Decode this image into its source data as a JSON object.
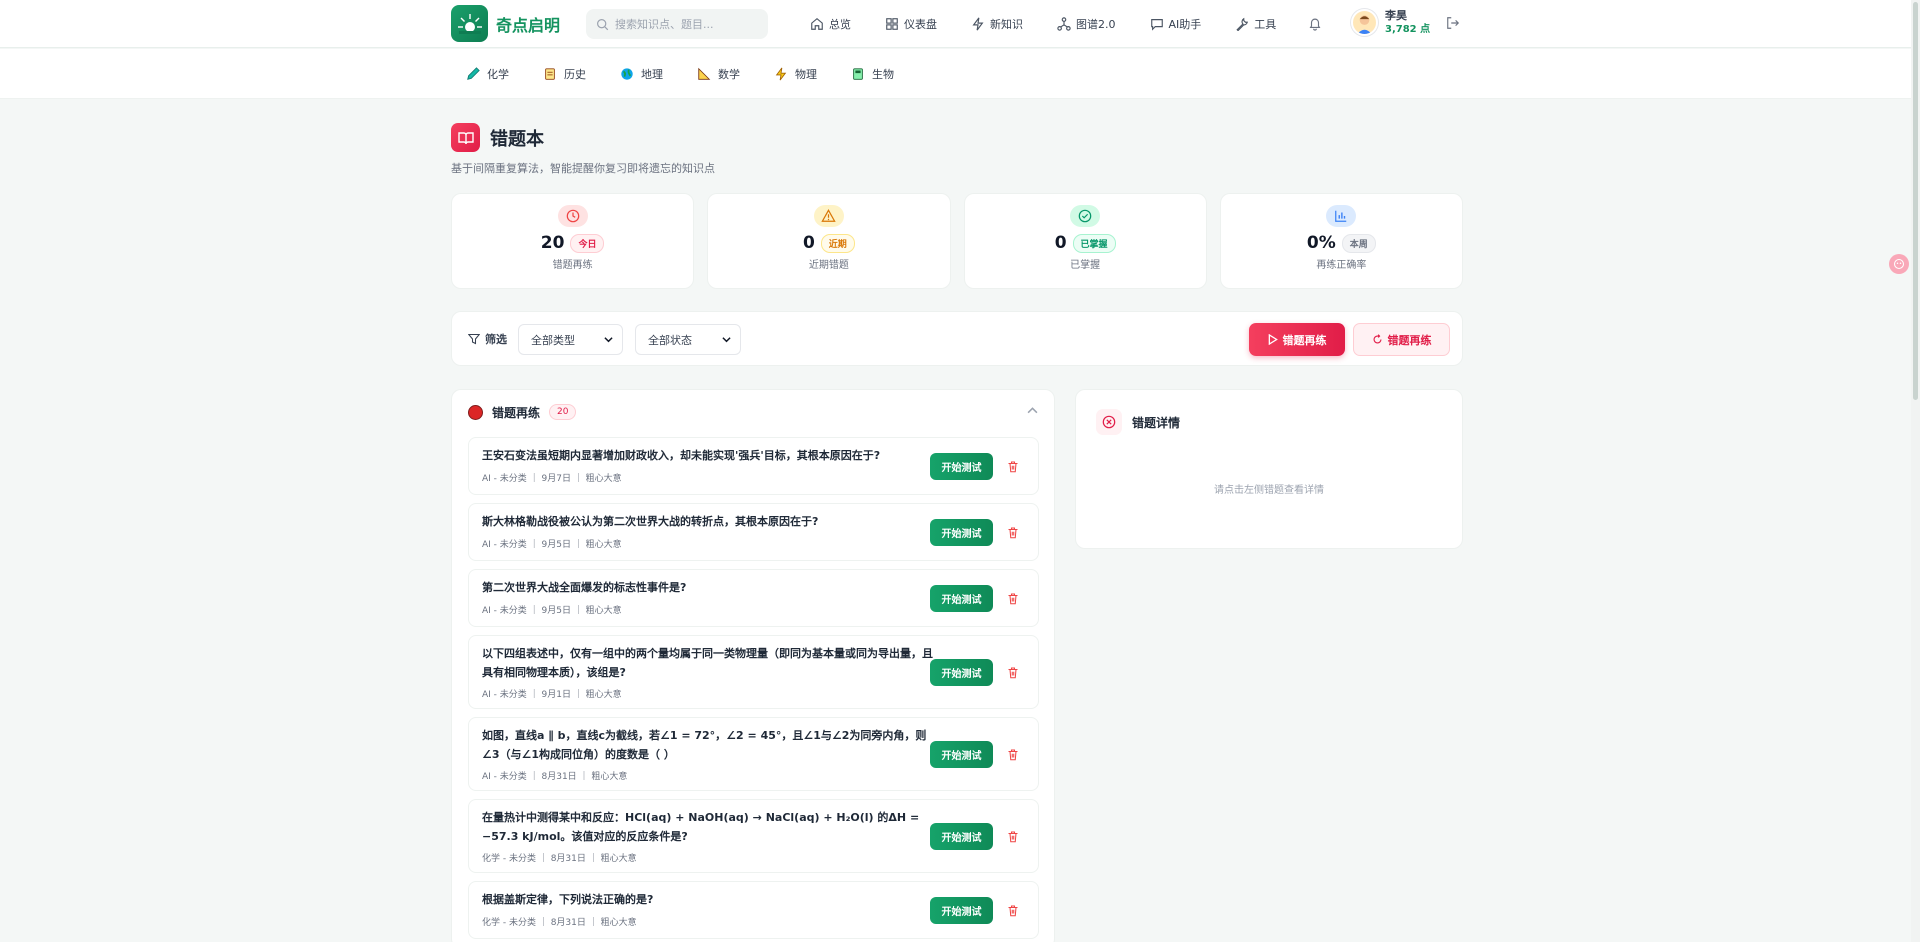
{
  "brand": {
    "name": "奇点启明"
  },
  "search": {
    "placeholder": "搜索知识点、题目..."
  },
  "nav": {
    "items": [
      {
        "label": "总览",
        "icon": "home-icon"
      },
      {
        "label": "仪表盘",
        "icon": "dashboard-icon"
      },
      {
        "label": "新知识",
        "icon": "lightning-icon"
      },
      {
        "label": "图谱2.0",
        "icon": "graph-icon"
      },
      {
        "label": "AI助手",
        "icon": "chat-icon"
      },
      {
        "label": "工具",
        "icon": "wrench-icon"
      }
    ]
  },
  "user": {
    "name": "李昊",
    "points": "3,782 点"
  },
  "subjects": [
    {
      "label": "化学",
      "icon": "flask-icon"
    },
    {
      "label": "历史",
      "icon": "scroll-icon"
    },
    {
      "label": "地理",
      "icon": "globe-icon"
    },
    {
      "label": "数学",
      "icon": "ruler-icon"
    },
    {
      "label": "物理",
      "icon": "bolt-icon"
    },
    {
      "label": "生物",
      "icon": "book-icon"
    }
  ],
  "page": {
    "title": "错题本",
    "subtitle": "基于间隔重复算法，智能提醒你复习即将遗忘的知识点"
  },
  "stats": [
    {
      "value": "20",
      "badge": "今日",
      "label": "错题再练",
      "color": "#ef4444",
      "bg": "#fee2e2",
      "badge_bg": "#fff1f2",
      "badge_color": "#e11d48",
      "badge_border": "#fecdd3"
    },
    {
      "value": "0",
      "badge": "近期",
      "label": "近期错题",
      "color": "#d97706",
      "bg": "#fef3c7",
      "badge_bg": "#fffbeb",
      "badge_color": "#d97706",
      "badge_border": "#fde68a"
    },
    {
      "value": "0",
      "badge": "已掌握",
      "label": "已掌握",
      "color": "#059669",
      "bg": "#d1fae5",
      "badge_bg": "#ecfdf5",
      "badge_color": "#059669",
      "badge_border": "#a7f3d0"
    },
    {
      "value": "0%",
      "badge": "本周",
      "label": "再练正确率",
      "color": "#3b82f6",
      "bg": "#dbeafe",
      "badge_bg": "#f3f4f6",
      "badge_color": "#6b7280",
      "badge_border": "#e5e7eb"
    }
  ],
  "filter": {
    "label": "筛选",
    "type_select": "全部类型",
    "status_select": "全部状态",
    "primary_button": "错题再练",
    "secondary_button": "错题再练"
  },
  "list": {
    "title": "错题再练",
    "count": "20",
    "test_button": "开始测试",
    "items": [
      {
        "question": "王安石变法虽短期内显著增加财政收入，却未能实现'强兵'目标，其根本原因在于?",
        "meta": "AI - 未分类 ｜ 9月7日 ｜ 粗心大意"
      },
      {
        "question": "斯大林格勒战役被公认为第二次世界大战的转折点，其根本原因在于?",
        "meta": "AI - 未分类 ｜ 9月5日 ｜ 粗心大意"
      },
      {
        "question": "第二次世界大战全面爆发的标志性事件是?",
        "meta": "AI - 未分类 ｜ 9月5日 ｜ 粗心大意"
      },
      {
        "question": "以下四组表述中，仅有一组中的两个量均属于同一类物理量（即同为基本量或同为导出量，且具有相同物理本质），该组是?",
        "meta": "AI - 未分类 ｜ 9月1日 ｜ 粗心大意"
      },
      {
        "question": "如图，直线a ∥ b，直线c为截线，若∠1 = 72°，∠2 = 45°，且∠1与∠2为同旁内角，则∠3（与∠1构成同位角）的度数是（ ）",
        "meta": "AI - 未分类 ｜ 8月31日 ｜ 粗心大意"
      },
      {
        "question": "在量热计中测得某中和反应：HCl(aq) + NaOH(aq) → NaCl(aq) + H₂O(l) 的ΔH = −57.3 kJ/mol。该值对应的反应条件是?",
        "meta": "化学 - 未分类 ｜ 8月31日 ｜ 粗心大意"
      },
      {
        "question": "根据盖斯定律，下列说法正确的是?",
        "meta": "化学 - 未分类 ｜ 8月31日 ｜ 粗心大意"
      }
    ]
  },
  "detail": {
    "title": "错题详情",
    "empty": "请点击左侧错题查看详情"
  }
}
